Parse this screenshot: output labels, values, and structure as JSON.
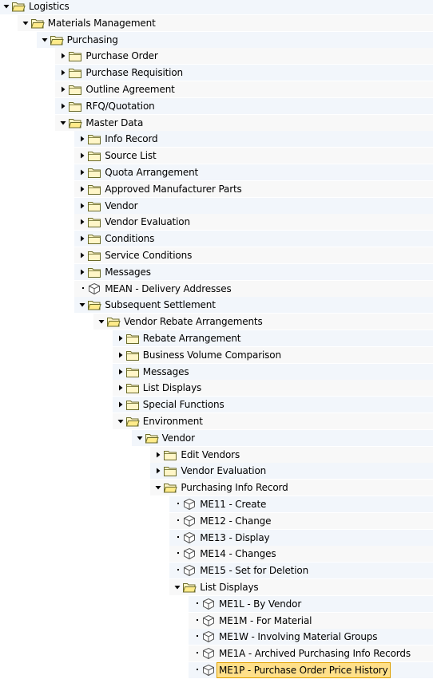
{
  "colors": {
    "band": "#e8eef7",
    "band_alt": "#f2f2f2",
    "folder_fill": "#fff6c8",
    "folder_stroke": "#6b6b2a",
    "selection_bg": "#ffe08a",
    "selection_border": "#e0a000"
  },
  "tree": [
    {
      "label": "Logistics",
      "level": 0,
      "type": "folder",
      "state": "expanded",
      "icon": "folder-open-icon"
    },
    {
      "label": "Materials Management",
      "level": 1,
      "type": "folder",
      "state": "expanded",
      "icon": "folder-open-icon"
    },
    {
      "label": "Purchasing",
      "level": 2,
      "type": "folder",
      "state": "expanded",
      "icon": "folder-open-icon"
    },
    {
      "label": "Purchase Order",
      "level": 3,
      "type": "folder",
      "state": "collapsed",
      "icon": "folder-icon"
    },
    {
      "label": "Purchase Requisition",
      "level": 3,
      "type": "folder",
      "state": "collapsed",
      "icon": "folder-icon"
    },
    {
      "label": "Outline Agreement",
      "level": 3,
      "type": "folder",
      "state": "collapsed",
      "icon": "folder-icon"
    },
    {
      "label": "RFQ/Quotation",
      "level": 3,
      "type": "folder",
      "state": "collapsed",
      "icon": "folder-icon"
    },
    {
      "label": "Master Data",
      "level": 3,
      "type": "folder",
      "state": "expanded",
      "icon": "folder-open-icon"
    },
    {
      "label": "Info Record",
      "level": 4,
      "type": "folder",
      "state": "collapsed",
      "icon": "folder-icon"
    },
    {
      "label": "Source List",
      "level": 4,
      "type": "folder",
      "state": "collapsed",
      "icon": "folder-icon"
    },
    {
      "label": "Quota Arrangement",
      "level": 4,
      "type": "folder",
      "state": "collapsed",
      "icon": "folder-icon"
    },
    {
      "label": "Approved Manufacturer Parts",
      "level": 4,
      "type": "folder",
      "state": "collapsed",
      "icon": "folder-icon"
    },
    {
      "label": "Vendor",
      "level": 4,
      "type": "folder",
      "state": "collapsed",
      "icon": "folder-icon"
    },
    {
      "label": "Vendor Evaluation",
      "level": 4,
      "type": "folder",
      "state": "collapsed",
      "icon": "folder-icon"
    },
    {
      "label": "Conditions",
      "level": 4,
      "type": "folder",
      "state": "collapsed",
      "icon": "folder-icon"
    },
    {
      "label": "Service Conditions",
      "level": 4,
      "type": "folder",
      "state": "collapsed",
      "icon": "folder-icon"
    },
    {
      "label": "Messages",
      "level": 4,
      "type": "folder",
      "state": "collapsed",
      "icon": "folder-icon"
    },
    {
      "label": "MEAN - Delivery Addresses",
      "level": 4,
      "type": "transaction",
      "icon": "transaction-cube-icon"
    },
    {
      "label": "Subsequent Settlement",
      "level": 4,
      "type": "folder",
      "state": "expanded",
      "icon": "folder-open-icon"
    },
    {
      "label": "Vendor Rebate Arrangements",
      "level": 5,
      "type": "folder",
      "state": "expanded",
      "icon": "folder-open-icon"
    },
    {
      "label": "Rebate Arrangement",
      "level": 6,
      "type": "folder",
      "state": "collapsed",
      "icon": "folder-icon"
    },
    {
      "label": "Business Volume Comparison",
      "level": 6,
      "type": "folder",
      "state": "collapsed",
      "icon": "folder-icon"
    },
    {
      "label": "Messages",
      "level": 6,
      "type": "folder",
      "state": "collapsed",
      "icon": "folder-icon"
    },
    {
      "label": "List Displays",
      "level": 6,
      "type": "folder",
      "state": "collapsed",
      "icon": "folder-icon"
    },
    {
      "label": "Special Functions",
      "level": 6,
      "type": "folder",
      "state": "collapsed",
      "icon": "folder-icon"
    },
    {
      "label": "Environment",
      "level": 6,
      "type": "folder",
      "state": "expanded",
      "icon": "folder-open-icon"
    },
    {
      "label": "Vendor",
      "level": 7,
      "type": "folder",
      "state": "expanded",
      "icon": "folder-open-icon"
    },
    {
      "label": "Edit Vendors",
      "level": 8,
      "type": "folder",
      "state": "collapsed",
      "icon": "folder-icon"
    },
    {
      "label": "Vendor Evaluation",
      "level": 8,
      "type": "folder",
      "state": "collapsed",
      "icon": "folder-icon"
    },
    {
      "label": "Purchasing Info Record",
      "level": 8,
      "type": "folder",
      "state": "expanded",
      "icon": "folder-open-icon"
    },
    {
      "label": "ME11 - Create",
      "level": 9,
      "type": "transaction",
      "icon": "transaction-cube-icon"
    },
    {
      "label": "ME12 - Change",
      "level": 9,
      "type": "transaction",
      "icon": "transaction-cube-icon"
    },
    {
      "label": "ME13 - Display",
      "level": 9,
      "type": "transaction",
      "icon": "transaction-cube-icon"
    },
    {
      "label": "ME14 - Changes",
      "level": 9,
      "type": "transaction",
      "icon": "transaction-cube-icon"
    },
    {
      "label": "ME15 - Set for Deletion",
      "level": 9,
      "type": "transaction",
      "icon": "transaction-cube-icon"
    },
    {
      "label": "List Displays",
      "level": 9,
      "type": "folder",
      "state": "expanded",
      "icon": "folder-open-icon"
    },
    {
      "label": "ME1L - By Vendor",
      "level": 10,
      "type": "transaction",
      "icon": "transaction-cube-icon"
    },
    {
      "label": "ME1M - For Material",
      "level": 10,
      "type": "transaction",
      "icon": "transaction-cube-icon"
    },
    {
      "label": "ME1W - Involving Material Groups",
      "level": 10,
      "type": "transaction",
      "icon": "transaction-cube-icon"
    },
    {
      "label": "ME1A - Archived Purchasing Info Records",
      "level": 10,
      "type": "transaction",
      "icon": "transaction-cube-icon"
    },
    {
      "label": "ME1P - Purchase Order Price History",
      "level": 10,
      "type": "transaction",
      "icon": "transaction-cube-icon",
      "selected": true
    }
  ]
}
